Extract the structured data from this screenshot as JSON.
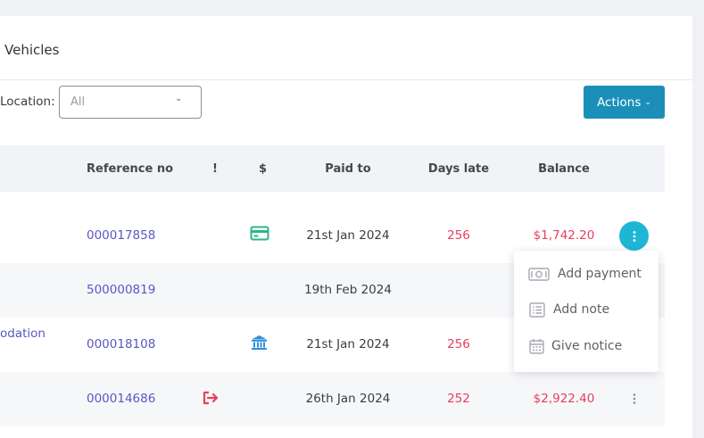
{
  "header": {
    "title": "Vehicles"
  },
  "filters": {
    "location_label": "Location:",
    "location_value": "All"
  },
  "toolbar": {
    "actions_label": "Actions"
  },
  "table": {
    "columns": [
      "Reference no",
      "!",
      "$",
      "Paid to",
      "Days late",
      "Balance"
    ],
    "rows": [
      {
        "partial": "",
        "reference": "000017858",
        "alert_icon": "",
        "payment_icon": "card-icon",
        "paid_to": "21st Jan 2024",
        "days_late": "256",
        "balance": "$1,742.20",
        "menu_open": true
      },
      {
        "partial": "",
        "reference": "500000819",
        "alert_icon": "",
        "payment_icon": "",
        "paid_to": "19th Feb 2024",
        "days_late": "",
        "balance": "",
        "menu_open": false
      },
      {
        "partial": "odation",
        "reference": "000018108",
        "alert_icon": "",
        "payment_icon": "bank-icon",
        "paid_to": "21st Jan 2024",
        "days_late": "256",
        "balance": "",
        "menu_open": false
      },
      {
        "partial": "",
        "reference": "000014686",
        "alert_icon": "exit-icon",
        "payment_icon": "",
        "paid_to": "26th Jan 2024",
        "days_late": "252",
        "balance": "$2,922.40",
        "menu_open": false
      }
    ]
  },
  "row_menu": {
    "items": [
      {
        "label": "Add payment",
        "icon": "cash-icon"
      },
      {
        "label": "Add note",
        "icon": "list-icon"
      },
      {
        "label": "Give notice",
        "icon": "calendar-icon"
      }
    ]
  },
  "colors": {
    "accent": "#1b8fb8",
    "kebab_active": "#1fb6d6",
    "link": "#5a57c4",
    "negative": "#e6405a",
    "card_icon": "#2bb58a",
    "bank_icon": "#2f8fd8",
    "exit_icon": "#e6405a"
  }
}
